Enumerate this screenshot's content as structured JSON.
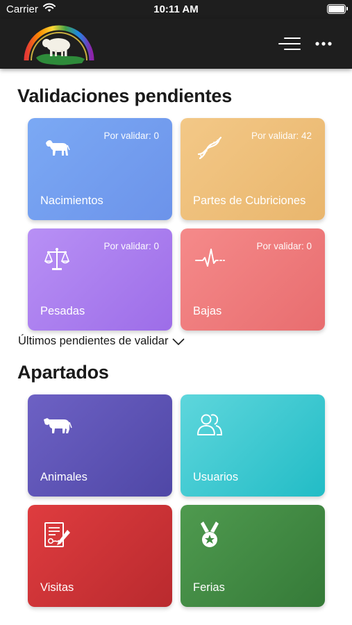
{
  "status_bar": {
    "carrier": "Carrier",
    "time": "10:11 AM"
  },
  "nav": {
    "logo_icon": "association-logo",
    "menu_icon": "menu-lines-icon",
    "more_icon": "more-dots-icon"
  },
  "validaciones": {
    "title": "Validaciones pendientes",
    "cards": [
      {
        "label": "Nacimientos",
        "count": "Por validar: 0",
        "icon": "calf-icon",
        "color": "#7ba9f4"
      },
      {
        "label": "Partes de Cubriciones",
        "count": "Por validar: 42",
        "icon": "dna-icon",
        "color": "#f3c887"
      },
      {
        "label": "Pesadas",
        "count": "Por validar: 0",
        "icon": "scale-icon",
        "color": "#b890f5"
      },
      {
        "label": "Bajas",
        "count": "Por validar: 0",
        "icon": "heartbeat-icon",
        "color": "#f58a8a"
      }
    ],
    "pending_toggle": "Últimos pendientes de validar"
  },
  "apartados": {
    "title": "Apartados",
    "cards": [
      {
        "label": "Animales",
        "icon": "cow-icon",
        "color": "#5a51b5"
      },
      {
        "label": "Usuarios",
        "icon": "users-icon",
        "color": "#36c6cf"
      },
      {
        "label": "Visitas",
        "icon": "document-pen-icon",
        "color": "#cf3337"
      },
      {
        "label": "Ferias",
        "icon": "medal-icon",
        "color": "#418a43"
      }
    ]
  }
}
